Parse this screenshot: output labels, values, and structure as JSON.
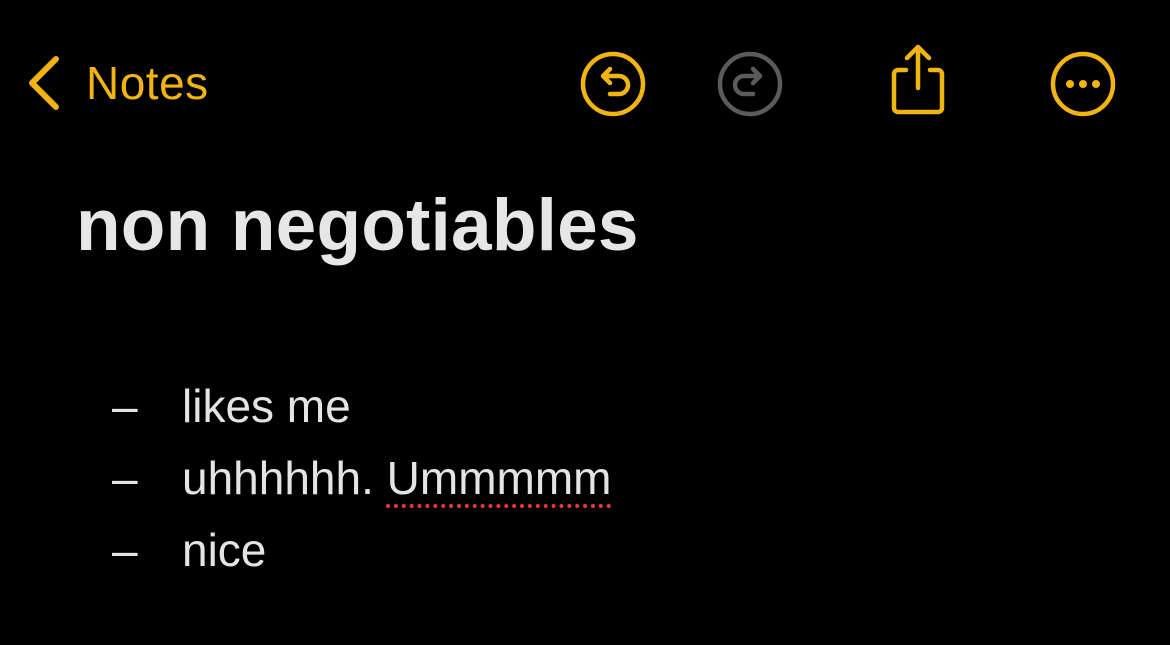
{
  "toolbar": {
    "back_label": "Notes",
    "back_icon": "chevron-left-icon",
    "accent_color": "#f1b413",
    "disabled_color": "#5b5b5b",
    "buttons": [
      {
        "icon": "undo-icon",
        "enabled": true
      },
      {
        "icon": "redo-icon",
        "enabled": false
      },
      {
        "icon": "share-icon",
        "enabled": true
      },
      {
        "icon": "more-icon",
        "enabled": true
      }
    ]
  },
  "note": {
    "title": "non negotiables",
    "bullet": "–",
    "items": [
      {
        "text": "likes me"
      },
      {
        "text_plain": "uhhhhhh. ",
        "text_misspelled": "Ummmmm"
      },
      {
        "text": "nice"
      }
    ],
    "spellcheck_color": "#e5383b"
  }
}
